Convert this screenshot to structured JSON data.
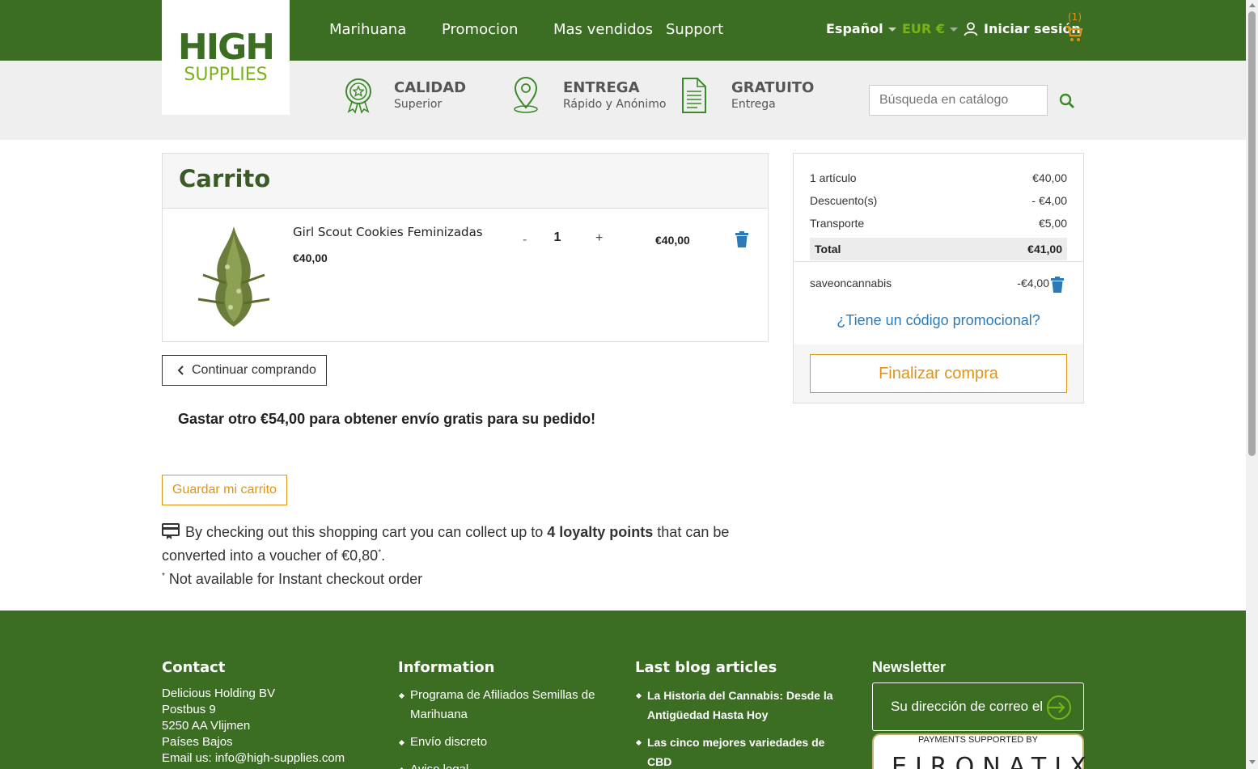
{
  "header": {
    "logo_top": "HIGH",
    "logo_bottom": "SUPPLIES",
    "nav": [
      "Marihuana",
      "Promocion",
      "Mas vendidos",
      "Support"
    ],
    "language": "Español",
    "currency": "EUR €",
    "login": "Iniciar sesión",
    "cart_count": "(1)"
  },
  "features": [
    {
      "title": "CALIDAD",
      "subtitle": "Superior",
      "icon": "award-icon"
    },
    {
      "title": "ENTREGA",
      "subtitle": "Rápido y Anónimo",
      "icon": "location-pin-icon"
    },
    {
      "title": "GRATUITO",
      "subtitle": "Entrega",
      "icon": "document-icon"
    }
  ],
  "search": {
    "placeholder": "Búsqueda en catálogo"
  },
  "cart": {
    "title": "Carrito",
    "item": {
      "name": "Girl Scout Cookies Feminizadas",
      "price": "€40,00",
      "qty_minus": "-",
      "quantity": "1",
      "qty_plus": "+",
      "line_total": "€40,00"
    },
    "continue_label": "Continuar comprando",
    "free_shipping_msg": "Gastar otro €54,00 para obtener envío gratis para su pedido!",
    "save_label": "Guardar mi carrito",
    "loyalty": {
      "text_before": "By checking out this shopping cart you can collect up to ",
      "points": "4 loyalty points",
      "text_after": " that can be converted into a voucher of €0,80",
      "star": "*",
      "text_end": ".",
      "note": " Not available for Instant checkout order"
    }
  },
  "summary": {
    "items_label": "1 artículo",
    "items_value": "€40,00",
    "discount_label": "Descuento(s)",
    "discount_value": "- €4,00",
    "shipping_label": "Transporte",
    "shipping_value": "€5,00",
    "total_label": "Total",
    "total_value": "€41,00",
    "voucher_code": "saveoncannabis",
    "voucher_value": "-€4,00",
    "promo_link": "¿Tiene un código promocional?",
    "checkout_label": "Finalizar compra"
  },
  "footer": {
    "contact_title": "Contact",
    "contact_lines": [
      "Delicious Holding BV",
      "Postbus 9",
      "5250 AA Vlijmen",
      "Países Bajos",
      "Email us: info@high-supplies.com"
    ],
    "info_title": "Information",
    "info_items": [
      "Programa de Afiliados Semillas de Marihuana",
      "Envío discreto",
      "Aviso legal"
    ],
    "blog_title": "Last blog articles",
    "blog_items": [
      "La Historia del Cannabis: Desde la Antigüedad Hasta Hoy",
      "Las cinco mejores variedades de CBD"
    ],
    "newsletter_title": "Newsletter",
    "newsletter_placeholder": "Su dirección de correo el",
    "payments_title": "PAYMENTS SUPPORTED BY",
    "payments_logo": "EIRONATIX"
  },
  "colors": {
    "brand_green": "#3b6e22",
    "accent_orange": "#e09316",
    "link_blue": "#2c7ab8",
    "lime": "#7ab317"
  }
}
